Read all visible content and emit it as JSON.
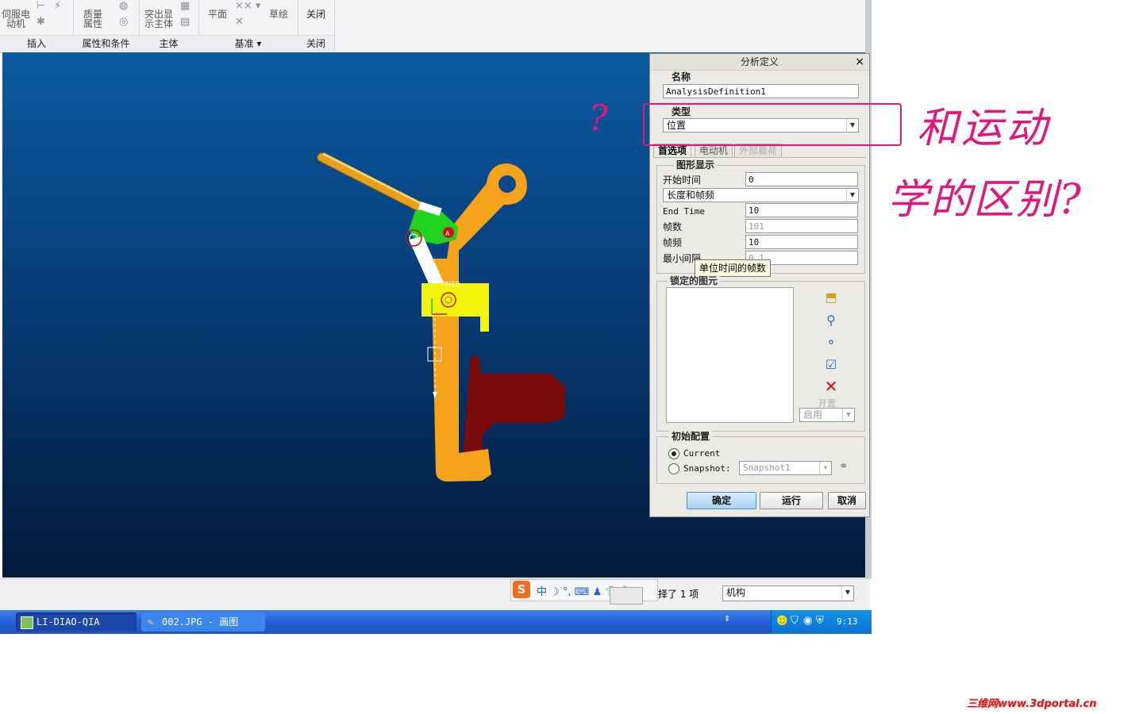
{
  "ribbon": {
    "groups": [
      {
        "label": "插入"
      },
      {
        "label": "属性和条件"
      },
      {
        "label": "主体"
      },
      {
        "label": "基准 ▾"
      },
      {
        "label": "关闭"
      }
    ],
    "buttons": {
      "servo_motor": "伺服电\n动机",
      "mass_properties": "质量\n属性",
      "highlight_body": "突出显\n示主体",
      "plane": "平面",
      "sketch": "草绘",
      "close": "关闭"
    }
  },
  "viewport": {
    "pnt_label": "PNT0"
  },
  "dialog": {
    "title": "分析定义",
    "close_glyph": "×",
    "name_label": "名称",
    "name_value": "AnalysisDefinition1",
    "type_label": "类型",
    "type_value": "位置",
    "tabs": [
      "首选项",
      "电动机",
      "外部载荷"
    ],
    "graphics_label": "图形显示",
    "start_time_label": "开始时间",
    "start_time_value": "0",
    "mode_value": "长度和帧频",
    "end_time_label": "End Time",
    "end_time_value": "10",
    "frames_label": "帧数",
    "frames_value": "101",
    "frame_rate_label": "帧频",
    "frame_rate_value": "10",
    "min_interval_label": "最小间隔",
    "min_interval_value": "0.1",
    "tooltip": "单位时间的帧数",
    "locked_label": "锁定的图元",
    "open_label": "开置",
    "enable_value": "启用",
    "init_config_label": "初始配置",
    "current_label": "Current",
    "snapshot_label": "Snapshot:",
    "snapshot_value": "Snapshot1",
    "ok": "确定",
    "run": "运行",
    "cancel": "取消"
  },
  "statusbar": {
    "selected_text": "择了 1 项",
    "filter_value": "机构",
    "ime_glyphs": "中 ☽ °, ⌨ ♟ 👕 🔧"
  },
  "taskbar": {
    "task1": "LI-DIAO-QIA (活...",
    "task2": "002.JPG - 画图",
    "clock": "9:13"
  },
  "annotation": {
    "question": "?",
    "line1": "和运动",
    "line2": "学的区别?"
  },
  "watermark": "三维网www.3dportal.cn",
  "colors": {
    "viewport_top": "#0b5aa0",
    "viewport_bottom": "#031a3a",
    "annotation": "#e0187e",
    "orange_part": "#f5a31a",
    "dark_red_part": "#7a0a0a",
    "yellow_part": "#f4f40a",
    "green_part": "#1fd41f"
  }
}
